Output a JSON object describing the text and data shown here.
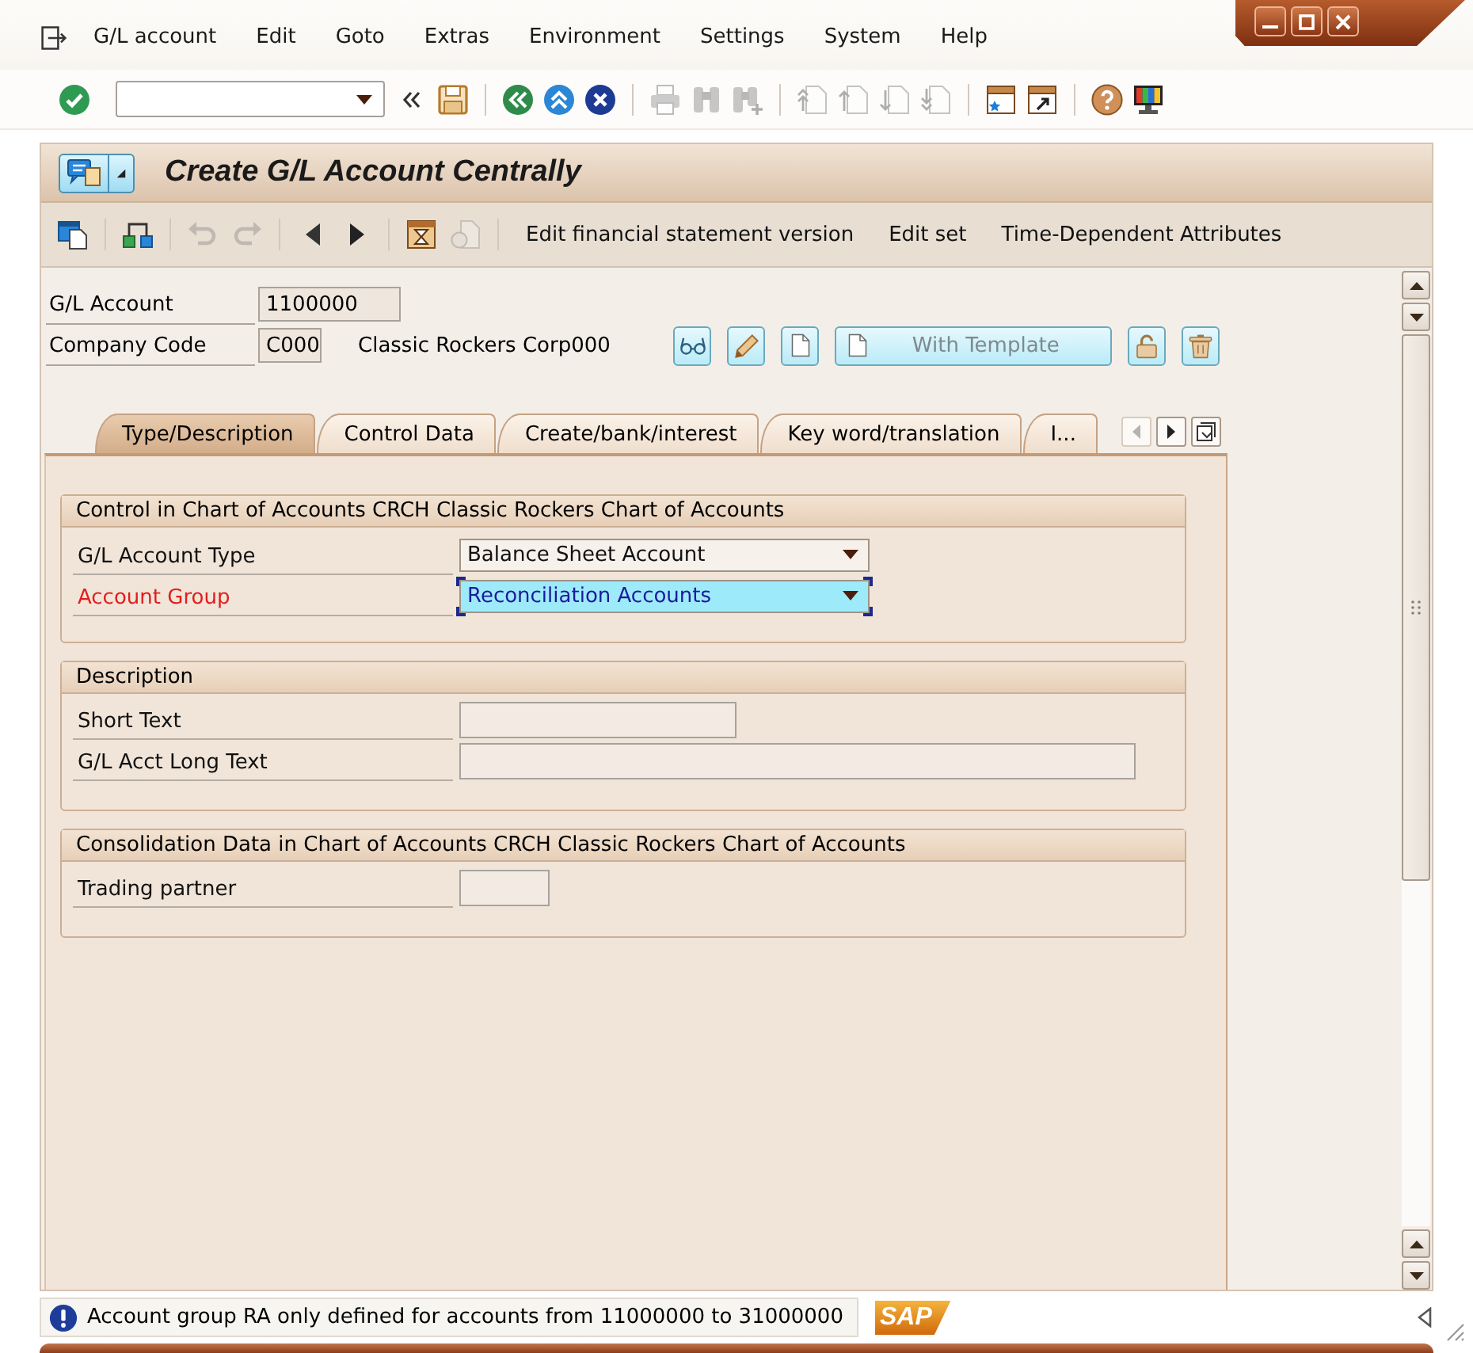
{
  "menu_bar": {
    "items": [
      "G/L account",
      "Edit",
      "Goto",
      "Extras",
      "Environment",
      "Settings",
      "System",
      "Help"
    ]
  },
  "toolbar": {
    "buttons": [
      {
        "disabled": false
      },
      {
        "disabled": false
      },
      {
        "disabled": false
      },
      {
        "disabled": false
      },
      {
        "disabled": false
      },
      {
        "disabled": true
      },
      {
        "disabled": true
      },
      {
        "disabled": true
      },
      {
        "disabled": true
      },
      {
        "disabled": true
      },
      {
        "disabled": true
      },
      {
        "disabled": true
      },
      {
        "disabled": false
      },
      {
        "disabled": false
      },
      {
        "disabled": false
      },
      {
        "disabled": false
      }
    ]
  },
  "title": "Create G/L Account Centrally",
  "app_toolbar": {
    "icon_buttons": [
      {
        "disabled": false
      },
      {
        "disabled": false
      },
      {
        "disabled": true
      },
      {
        "disabled": true
      },
      {
        "disabled": false
      },
      {
        "disabled": false
      },
      {
        "disabled": false
      },
      {
        "disabled": true
      }
    ],
    "text_buttons": [
      "Edit financial statement version",
      "Edit set",
      "Time-Dependent Attributes"
    ]
  },
  "header": {
    "fields": [
      {
        "label": "G/L Account",
        "value": "1100000"
      },
      {
        "label": "Company Code",
        "value": "C000",
        "description": "Classic Rockers Corp000"
      }
    ],
    "template_button": "With Template"
  },
  "tabs": [
    {
      "label": "Type/Description",
      "selected": true
    },
    {
      "label": "Control Data",
      "selected": false
    },
    {
      "label": "Create/bank/interest",
      "selected": false
    },
    {
      "label": "Key word/translation",
      "selected": false
    },
    {
      "label": "I...",
      "selected": false
    }
  ],
  "tab_nav": [
    {
      "disabled": true
    },
    {
      "disabled": false
    },
    {
      "disabled": false
    }
  ],
  "groups": [
    {
      "title": "Control in Chart of Accounts CRCH Classic Rockers Chart of Accounts",
      "fields": [
        {
          "label": "G/L Account Type",
          "kind": "dropdown",
          "value": "Balance Sheet Account",
          "error": false,
          "focused": false
        },
        {
          "label": "Account Group",
          "kind": "dropdown",
          "value": "Reconciliation Accounts",
          "error": true,
          "focused": true
        }
      ]
    },
    {
      "title": "Description",
      "fields": [
        {
          "label": "Short Text",
          "kind": "input",
          "error": false,
          "focused": false
        },
        {
          "label": "G/L Acct Long Text",
          "kind": "input",
          "error": false,
          "focused": false
        }
      ]
    },
    {
      "title": "Consolidation Data in Chart of Accounts CRCH Classic Rockers Chart of Accounts",
      "fields": [
        {
          "label": "Trading partner",
          "kind": "input",
          "error": false,
          "focused": false
        }
      ]
    }
  ],
  "status_bar": {
    "message": "Account group RA only defined for accounts from 11000000 to 31000000",
    "logo": "SAP"
  }
}
